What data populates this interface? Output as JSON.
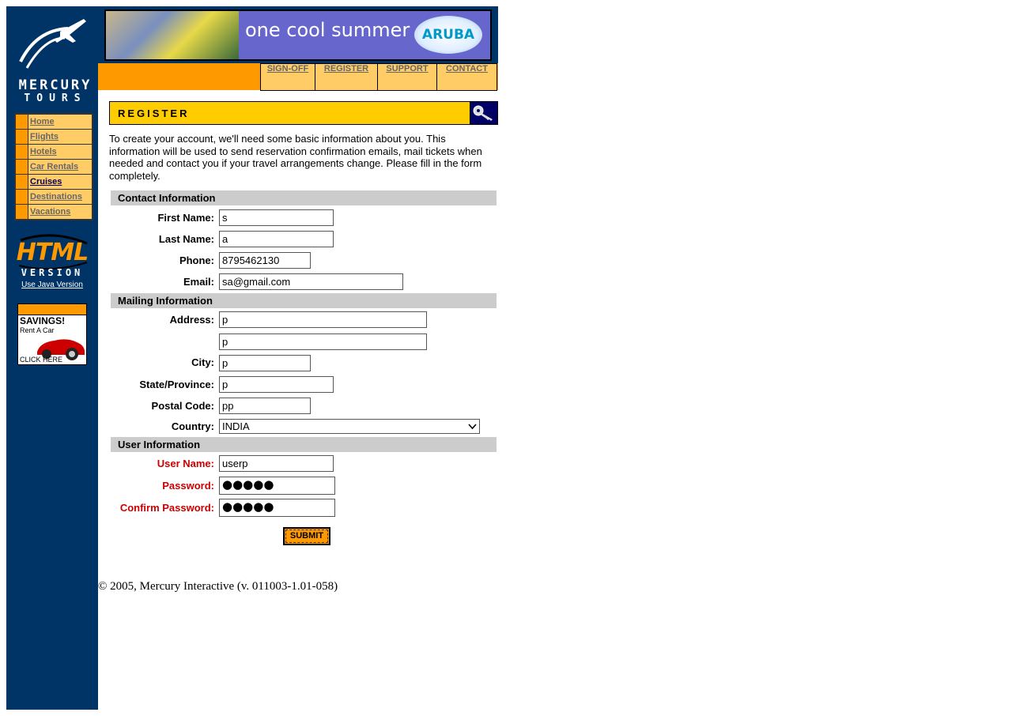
{
  "brand": {
    "line1": "MERCURY",
    "line2": "TOURS"
  },
  "sidebar": {
    "items": [
      {
        "label": "Home"
      },
      {
        "label": "Flights"
      },
      {
        "label": "Hotels"
      },
      {
        "label": "Car Rentals"
      },
      {
        "label": "Cruises"
      },
      {
        "label": "Destinations"
      },
      {
        "label": "Vacations"
      }
    ],
    "html_badge": {
      "line1": "HTML",
      "line2": "VERSION"
    },
    "java_link": "Use Java Version",
    "ad": {
      "title": "SAVINGS!",
      "subtitle": "Rent A Car",
      "cta": "CLICK HERE"
    }
  },
  "banner": {
    "text": "one cool summer",
    "badge": "ARUBA"
  },
  "topnav": {
    "items": [
      "SIGN-OFF",
      "REGISTER",
      "SUPPORT",
      "CONTACT"
    ]
  },
  "page": {
    "title": "REGISTER",
    "intro": "To create your account, we'll need some basic information about you. This information will be used to send reservation confirmation emails, mail tickets when needed and contact you if your travel arrangements change. Please fill in the form completely."
  },
  "form": {
    "contact": {
      "heading": "Contact Information",
      "first_name": {
        "label": "First Name:",
        "value": "s"
      },
      "last_name": {
        "label": "Last Name:",
        "value": "a"
      },
      "phone": {
        "label": "Phone:",
        "value": "8795462130"
      },
      "email": {
        "label": "Email:",
        "value": "sa@gmail.com"
      }
    },
    "mailing": {
      "heading": "Mailing Information",
      "address": {
        "label": "Address:",
        "value1": "p",
        "value2": "p"
      },
      "city": {
        "label": "City:",
        "value": "p"
      },
      "state": {
        "label": "State/Province:",
        "value": "p"
      },
      "postal": {
        "label": "Postal Code:",
        "value": "pp"
      },
      "country": {
        "label": "Country:",
        "value": "INDIA"
      }
    },
    "user": {
      "heading": "User Information",
      "username": {
        "label": "User Name:",
        "value": "userp"
      },
      "password": {
        "label": "Password:",
        "value": "●●●●●"
      },
      "confirm": {
        "label": "Confirm Password:",
        "value": "●●●●●"
      }
    },
    "submit_label": "SUBMIT"
  },
  "footer": "© 2005, Mercury Interactive (v. 011003-1.01-058)",
  "colors": {
    "sidebar": "#003366",
    "accent": "#ff9900",
    "nav_bg": "#ffcc66",
    "header": "#ffcc00",
    "required": "#cc0000"
  }
}
